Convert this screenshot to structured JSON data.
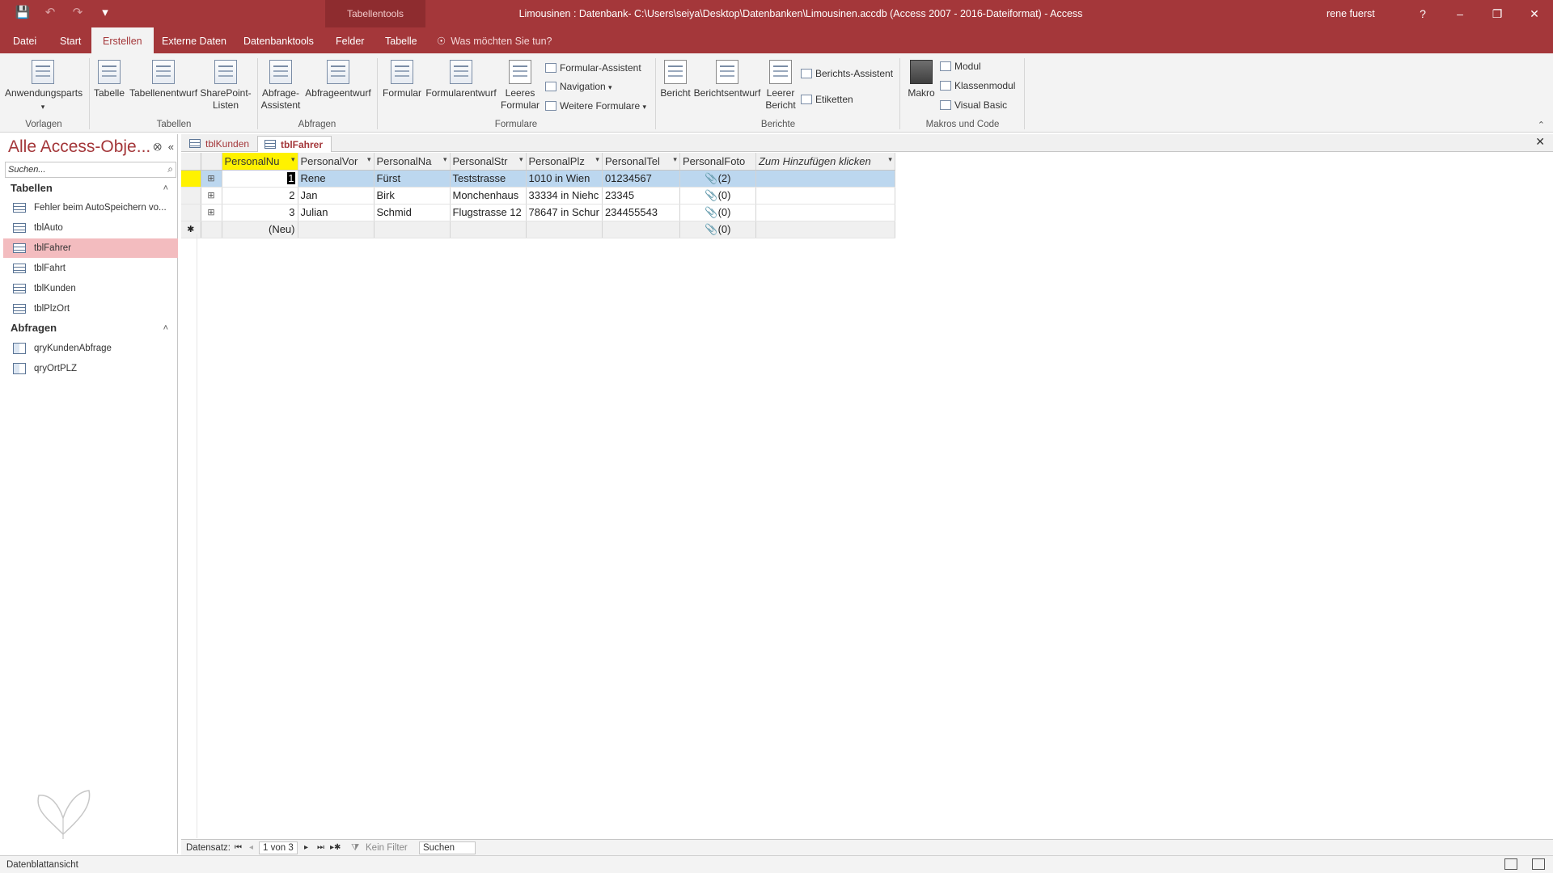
{
  "window": {
    "contextual_tab": "Tabellentools",
    "title": "Limousinen : Datenbank- C:\\Users\\seiya\\Desktop\\Datenbanken\\Limousinen.accdb (Access 2007 - 2016-Dateiformat)  -  Access",
    "user": "rene fuerst",
    "help": "?",
    "minimize": "–",
    "restore": "❐",
    "close": "✕",
    "qat": {
      "save_icon": "💾",
      "undo_icon": "↶",
      "redo_icon": "↷",
      "customize_icon": "▾"
    }
  },
  "tabs": [
    {
      "label": "Datei"
    },
    {
      "label": "Start"
    },
    {
      "label": "Erstellen",
      "active": true
    },
    {
      "label": "Externe Daten"
    },
    {
      "label": "Datenbanktools"
    },
    {
      "label": "Felder"
    },
    {
      "label": "Tabelle"
    }
  ],
  "tellme": {
    "text": "Was möchten Sie tun?",
    "icon": "☉"
  },
  "ribbon": {
    "vorlagen": {
      "group": "Vorlagen",
      "anwendungsparts": "Anwendungsparts"
    },
    "tabellen": {
      "group": "Tabellen",
      "tabelle": "Tabelle",
      "tabellenentwurf": "Tabellenentwurf",
      "sharepoint_1": "SharePoint-",
      "sharepoint_2": "Listen"
    },
    "abfragen": {
      "group": "Abfragen",
      "assistent_1": "Abfrage-",
      "assistent_2": "Assistent",
      "entwurf": "Abfrageentwurf"
    },
    "formulare": {
      "group": "Formulare",
      "formular": "Formular",
      "entwurf": "Formularentwurf",
      "leeres_1": "Leeres",
      "leeres_2": "Formular",
      "assistent": "Formular-Assistent",
      "navigation": "Navigation",
      "weitere": "Weitere Formulare"
    },
    "berichte": {
      "group": "Berichte",
      "bericht": "Bericht",
      "entwurf": "Berichtsentwurf",
      "leerer_1": "Leerer",
      "leerer_2": "Bericht",
      "assistent": "Berichts-Assistent",
      "etiketten": "Etiketten"
    },
    "makros": {
      "group": "Makros und Code",
      "makro": "Makro",
      "modul": "Modul",
      "klassenmodul": "Klassenmodul",
      "visual_basic": "Visual Basic"
    },
    "collapse_icon": "⌃"
  },
  "nav": {
    "title": "Alle Access-Obje...",
    "search_placeholder": "Suchen...",
    "search_icon": "⌕",
    "menu_icon": "⭙",
    "shutter_icon": "«",
    "groups": {
      "tabellen": "Tabellen",
      "abfragen": "Abfragen",
      "chevron": "˄"
    },
    "tables": [
      "Fehler beim AutoSpeichern vo...",
      "tblAuto",
      "tblFahrer",
      "tblFahrt",
      "tblKunden",
      "tblPlzOrt"
    ],
    "queries": [
      "qryKundenAbfrage",
      "qryOrtPLZ"
    ]
  },
  "doctabs": {
    "tab1": "tblKunden",
    "tab2": "tblFahrer",
    "close": "✕"
  },
  "datasheet": {
    "headers": [
      "PersonalNu",
      "PersonalVor",
      "PersonalNa",
      "PersonalStr",
      "PersonalPlz",
      "PersonalTel",
      "PersonalFoto",
      "Zum Hinzufügen klicken"
    ],
    "rows": [
      {
        "nr": "1",
        "vorname": "Rene",
        "nachname": "Fürst",
        "strasse": "Teststrasse",
        "plz": "1010 in Wien",
        "tel": "01234567",
        "foto": "(2)"
      },
      {
        "nr": "2",
        "vorname": "Jan",
        "nachname": "Birk",
        "strasse": "Monchenhaus",
        "plz": "33334 in Niehc",
        "tel": "23345",
        "foto": "(0)"
      },
      {
        "nr": "3",
        "vorname": "Julian",
        "nachname": "Schmid",
        "strasse": "Flugstrasse 12",
        "plz": "78647 in Schur",
        "tel": "234455543",
        "foto": "(0)"
      }
    ],
    "new_row": {
      "label": "(Neu)",
      "foto": "(0)"
    },
    "expand_icon": "⊞",
    "new_marker": "✱",
    "attach_icon": "📎",
    "dropdown_icon": "▾"
  },
  "recnav": {
    "label": "Datensatz:",
    "first": "⏮",
    "prev": "◂",
    "position": "1 von 3",
    "next": "▸",
    "last": "⏭",
    "new": "▸✱",
    "filter": "Kein Filter",
    "filter_icon": "⧩",
    "search": "Suchen"
  },
  "status": {
    "text": "Datenblattansicht"
  }
}
